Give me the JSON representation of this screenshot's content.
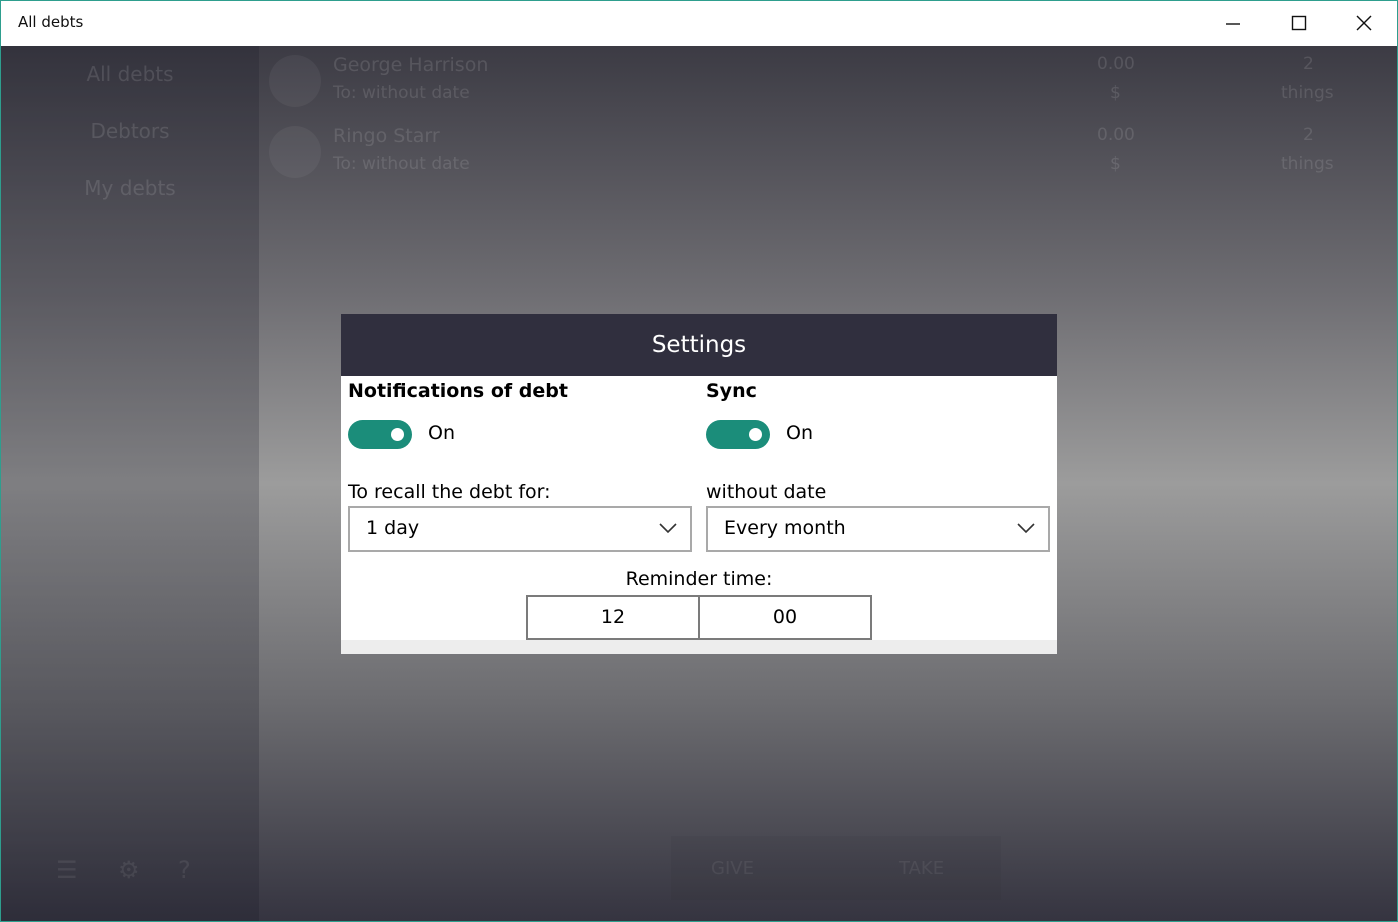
{
  "window": {
    "title": "All debts"
  },
  "sidebar": {
    "items": [
      {
        "label": "All debts"
      },
      {
        "label": "Debtors"
      },
      {
        "label": "My debts"
      }
    ]
  },
  "list": {
    "rows": [
      {
        "name": "George Harrison",
        "subtitle": "To: without date",
        "amount": "0.00",
        "currency": "$",
        "count": "2",
        "unit": "things"
      },
      {
        "name": "Ringo Starr",
        "subtitle": "To: without date",
        "amount": "0.00",
        "currency": "$",
        "count": "2",
        "unit": "things"
      }
    ]
  },
  "bottom_buttons": {
    "give": "GIVE",
    "take": "TAKE"
  },
  "settings": {
    "title": "Settings",
    "notifications": {
      "label": "Notifications of debt",
      "state": "On"
    },
    "sync": {
      "label": "Sync",
      "state": "On"
    },
    "recall": {
      "label": "To recall the debt for:",
      "value": "1 day"
    },
    "without_date": {
      "label": "without date",
      "value": "Every month"
    },
    "reminder": {
      "label": "Reminder time:",
      "hour": "12",
      "minute": "00"
    }
  },
  "colors": {
    "accent": "#1b8d7a",
    "dialog_header": "#302f3e",
    "window_border": "#2e9e8e"
  }
}
